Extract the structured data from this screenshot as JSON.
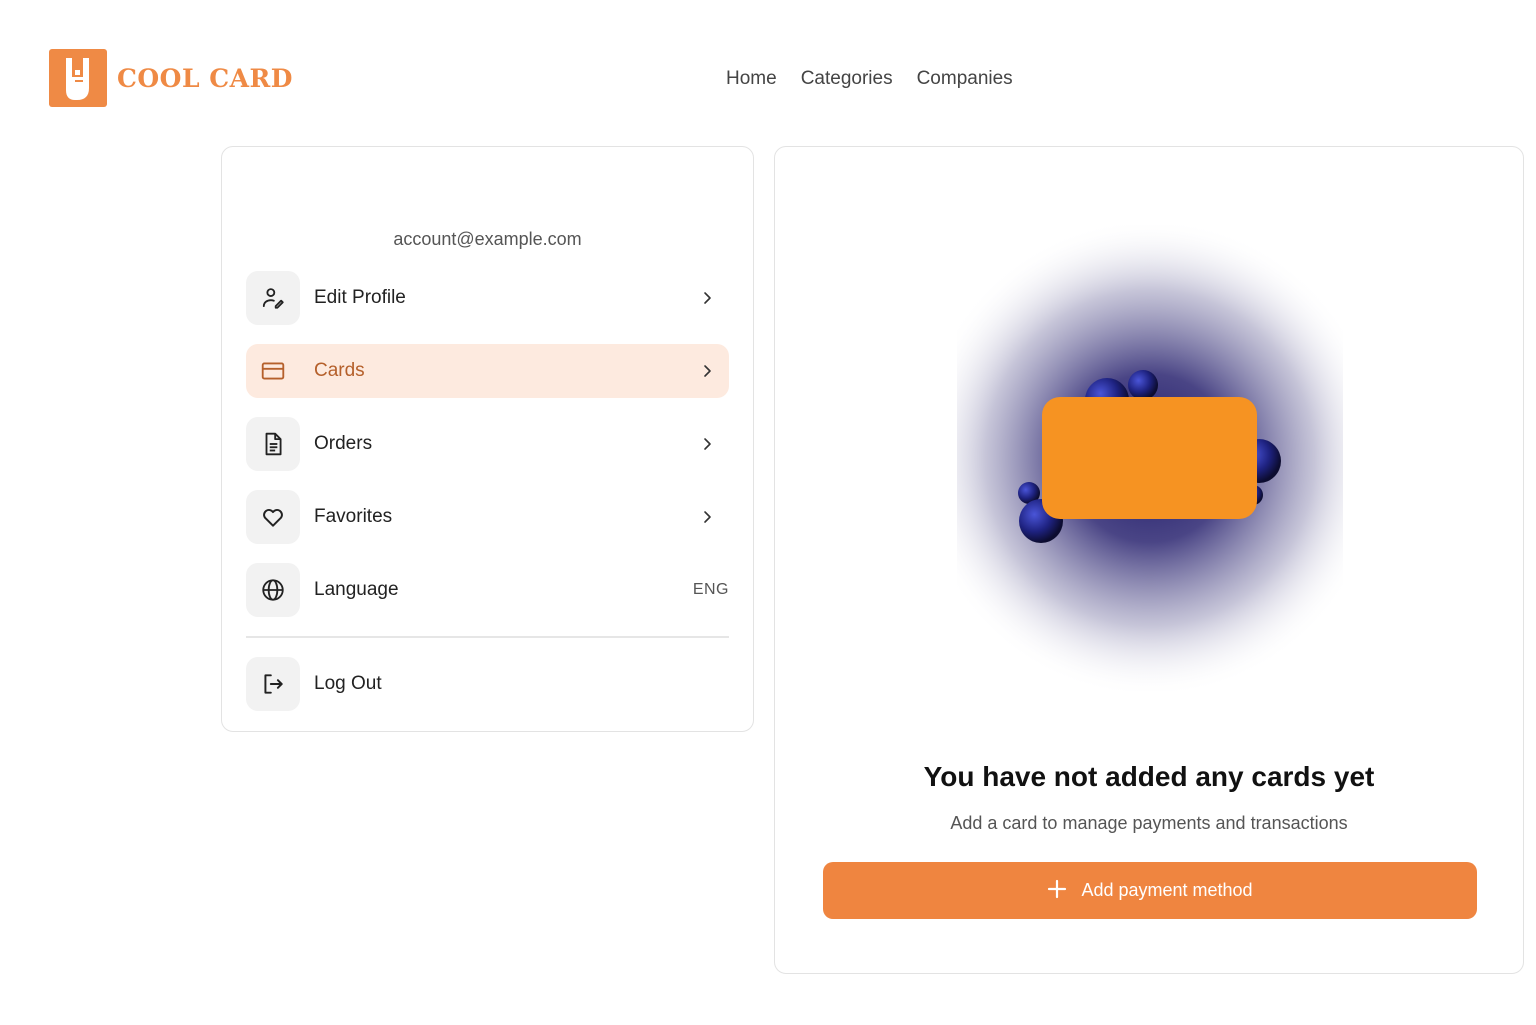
{
  "header": {
    "brand": "COOL CARD",
    "nav": [
      {
        "label": "Home"
      },
      {
        "label": "Categories"
      },
      {
        "label": "Companies"
      }
    ]
  },
  "account": {
    "email": "account@example.com"
  },
  "menu": {
    "items": [
      {
        "label": "Edit Profile",
        "icon": "edit-profile-icon"
      },
      {
        "label": "Cards",
        "icon": "credit-card-icon",
        "active": true
      },
      {
        "label": "Orders",
        "icon": "document-icon"
      },
      {
        "label": "Favorites",
        "icon": "heart-icon"
      },
      {
        "label": "Language",
        "icon": "globe-icon",
        "value": "ENG"
      }
    ],
    "logout": {
      "label": "Log Out",
      "icon": "logout-icon"
    }
  },
  "empty_state": {
    "title": "You have not added any cards yet",
    "subtitle": "Add a card to manage payments and transactions",
    "button_label": "Add payment method"
  },
  "colors": {
    "brand": "#ef8a45",
    "active_bg": "#fdeadf",
    "active_text": "#b5602b",
    "illustration_card": "#f69322",
    "illustration_glow": "#2a2470"
  }
}
